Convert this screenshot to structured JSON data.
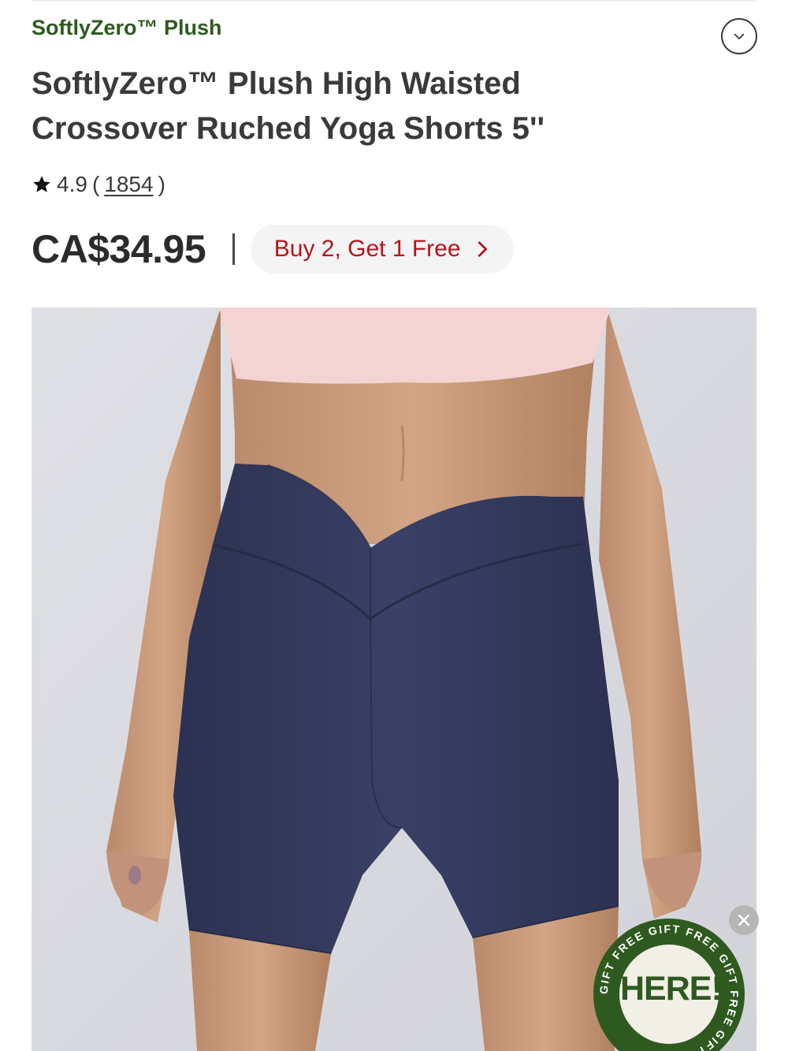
{
  "header": {
    "collection_label": "SoftlyZero™ Plush",
    "collapse_icon": "chevron-down-icon"
  },
  "product": {
    "title": "SoftlyZero™ Plush High Waisted Crossover Ruched Yoga Shorts 5''",
    "rating": "4.9",
    "rating_open": "(",
    "review_count": "1854",
    "rating_close": ")",
    "price": "CA$34.95",
    "promo_label": "Buy 2, Get 1 Free",
    "promo_icon": "chevron-right-icon",
    "image_alt": "Model wearing navy high waisted crossover shorts with light pink sports bra"
  },
  "gift_badge": {
    "main_text": "HERE!",
    "ring_text": "GIFT FREE GIFT FREE GIFT FREE GIFT FREE ",
    "close_icon": "close-icon"
  },
  "colors": {
    "brand_green": "#2e5a1f",
    "promo_red": "#b8131b",
    "shorts_navy": "#33395c",
    "bra_pink": "#f4d3d3",
    "image_bg": "#dcdde2"
  }
}
